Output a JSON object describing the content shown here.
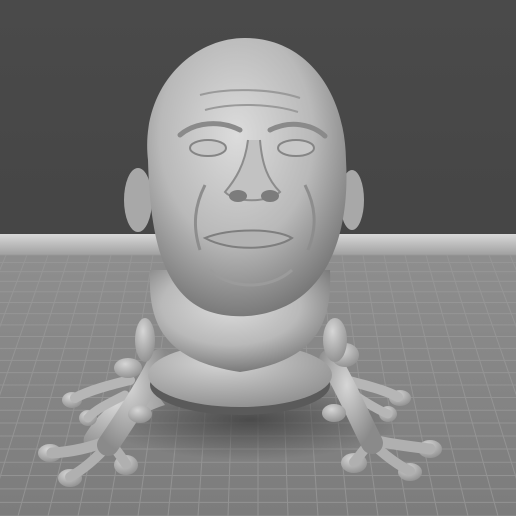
{
  "viewport": {
    "background": "#474747",
    "floor": "#878787",
    "grid_line": "#9d9d9d",
    "model_base": "#bdbdbd",
    "model_shadow": "#4e4e4e"
  },
  "model": {
    "subject": "sculpted-bald-head-on-frog-legs",
    "material": "matte-grey-clay"
  }
}
